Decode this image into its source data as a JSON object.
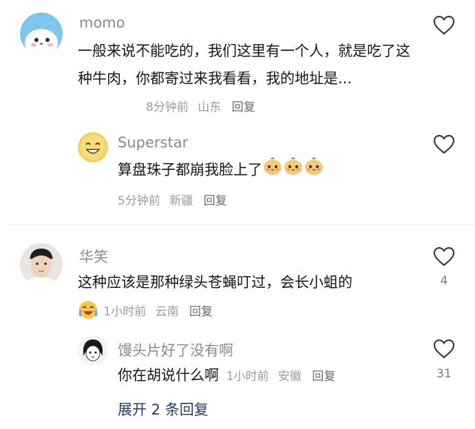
{
  "comments": [
    {
      "username": "momo",
      "text": "一般来说不能吃的，我们这里有一个人，就是吃了这种牛肉，你都寄过来我看看，我的地址是...",
      "time": "8分钟前",
      "location": "山东",
      "reply_label": "回复",
      "likes": "",
      "replies": [
        {
          "username": "Superstar",
          "text": "算盘珠子都崩我脸上了",
          "emojis": [
            "cute-face",
            "cute-face",
            "cute-face"
          ],
          "time": "5分钟前",
          "location": "新疆",
          "reply_label": "回复"
        }
      ]
    },
    {
      "username": "华笑",
      "text": "这种应该是那种绿头苍蝇叮过，会长小蛆的",
      "emoji_prefix": "crying-laugh",
      "time": "1小时前",
      "location": "云南",
      "reply_label": "回复",
      "likes": "4",
      "replies": [
        {
          "username": "馒头片好了没有啊",
          "text": "你在胡说什么啊",
          "time": "1小时前",
          "location": "安徽",
          "reply_label": "回复",
          "likes": "31"
        }
      ],
      "expand_label": "展开 2 条回复"
    }
  ],
  "colors": {
    "accent_link": "#263a66",
    "muted": "#9a9a9a",
    "name": "#8a8a8a"
  }
}
